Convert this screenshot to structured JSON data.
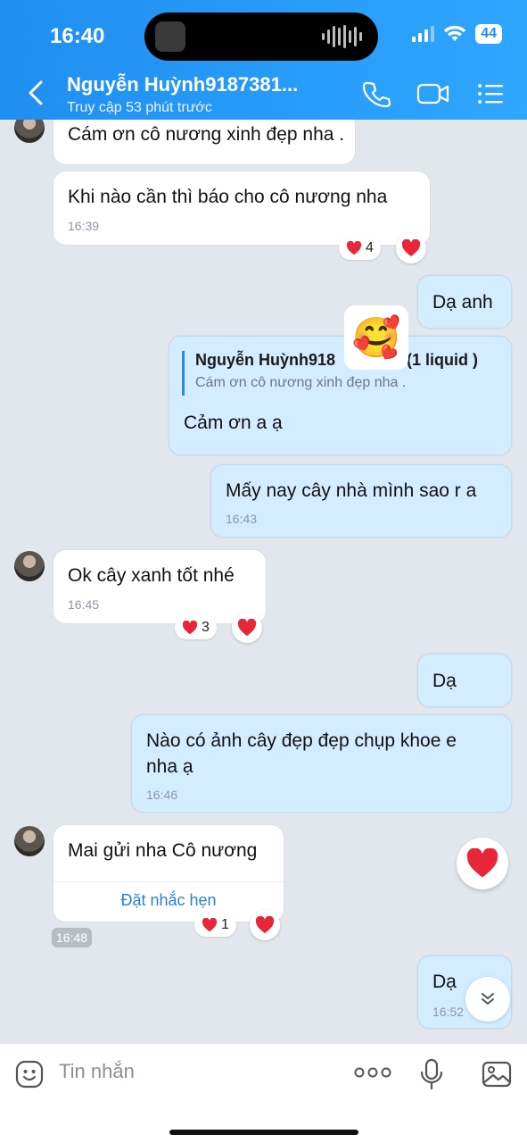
{
  "status_bar": {
    "time": "16:40",
    "battery": "44"
  },
  "header": {
    "contact_name": "Nguyễn Huỳnh9187381...",
    "contact_status": "Truy cập 53 phút trước",
    "icons": [
      "back-arrow-icon",
      "phone-icon",
      "video-icon",
      "menu-list-icon"
    ]
  },
  "messages": [
    {
      "id": "m1",
      "dir": "in",
      "text": "Cám ơn cô nương xinh đẹp nha ."
    },
    {
      "id": "m2",
      "dir": "in",
      "text": "Khi nào cần thì báo cho cô nương nha",
      "time": "16:39",
      "reaction_count": "4"
    },
    {
      "id": "m3",
      "dir": "out",
      "text": "Dạ anh"
    },
    {
      "id": "m4",
      "dir": "out",
      "text": "Cảm ơn a ạ",
      "quote": {
        "name": "Nguyễn Huỳnh918",
        "extra": "(1 liquid  )",
        "text": "Cám ơn cô nương xinh đẹp nha ."
      },
      "sticker": "🥰"
    },
    {
      "id": "m5",
      "dir": "out",
      "text": "Mấy nay cây nhà mình sao r a",
      "time": "16:43"
    },
    {
      "id": "m6",
      "dir": "in",
      "text": "Ok cây xanh tốt nhé",
      "time": "16:45",
      "reaction_count": "3"
    },
    {
      "id": "m7",
      "dir": "out",
      "text": "Dạ"
    },
    {
      "id": "m8",
      "dir": "out",
      "lines": [
        "Nào có ảnh cây đẹp đẹp chụp khoe e",
        "nha ạ"
      ],
      "time": "16:46"
    },
    {
      "id": "m9",
      "dir": "in",
      "text": "Mai gửi nha Cô nương",
      "action": "Đặt nhắc hẹn",
      "time": "16:48",
      "reaction_count": "1"
    },
    {
      "id": "m10",
      "dir": "out",
      "text": "Dạ",
      "time": "16:52"
    }
  ],
  "composer": {
    "placeholder": "Tin nhắn"
  },
  "colors": {
    "header": "#1f8ef1",
    "outgoing_bubble": "#d4ecff",
    "incoming_bubble": "#ffffff",
    "heart": "#e8263a",
    "link": "#2a7fd8"
  }
}
